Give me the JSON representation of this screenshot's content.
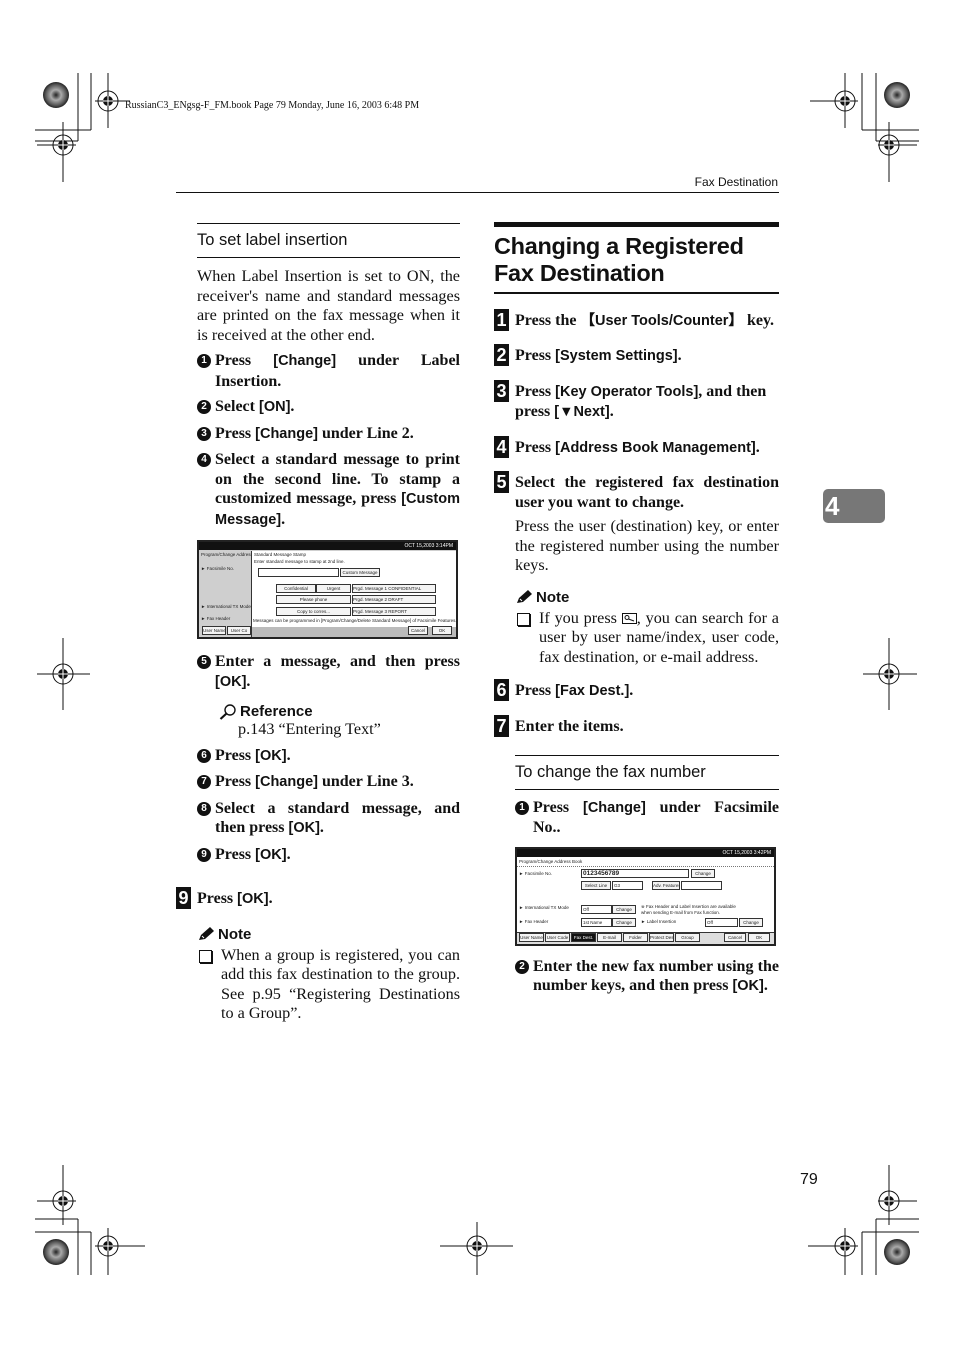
{
  "meta_line": "RussianC3_ENgsg-F_FM.book  Page 79  Monday, June 16, 2003  6:48 PM",
  "running_head": "Fax Destination",
  "chapter_tab": "4",
  "page_number": "79",
  "left": {
    "subhead": "To set label insertion",
    "intro": "When Label Insertion is set to ON, the receiver's name and standard messages are printed on the fax message when it is received at the other end.",
    "steps_a": [
      {
        "num": "1",
        "pre": "Press ",
        "key": "[Change]",
        "post": " under Label Insertion."
      },
      {
        "num": "2",
        "pre": "Select ",
        "key": "[ON]",
        "post": "."
      },
      {
        "num": "3",
        "pre": "Press ",
        "key": "[Change]",
        "post": " under Line 2."
      },
      {
        "num": "4",
        "pre": "Select a standard message to print on the second line. To stamp a customized message, press ",
        "key": "[Custom Message]",
        "post": "."
      }
    ],
    "screen1": {
      "clock": "OCT  15,2003  3:14PM",
      "side_title": "Program/Change Address B",
      "side_items": [
        "► Facsimile No.",
        "► International TX Mode",
        "► Fax Header"
      ],
      "side_tabs": [
        "User Name",
        "User Co"
      ],
      "dialog_title": "Standard Message Stamp",
      "dialog_prompt": "Enter standard message to stamp at 2nd line.",
      "custom_button": "Custom Message",
      "messages": [
        "Confidential",
        "Urgent",
        "Please phone",
        "Copy to corres..."
      ],
      "prgd": [
        {
          "label": "Prgd. Message 1",
          "value": "CONFIDENTIAL"
        },
        {
          "label": "Prgd. Message 2",
          "value": "DRAFT"
        },
        {
          "label": "Prgd. Message 3",
          "value": "REPORT"
        }
      ],
      "footer_note": "Messages can be programmed in [Program/Change/Delete Standard Message] of Facsimile Features.",
      "cancel": "Cancel",
      "ok": "OK"
    },
    "steps_b": [
      {
        "num": "5",
        "pre": "Enter a message, and then press ",
        "key": "[OK]",
        "post": "."
      }
    ],
    "reference_title": "Reference",
    "reference_text": "p.143 “Entering Text”",
    "steps_c": [
      {
        "num": "6",
        "pre": "Press ",
        "key": "[OK]",
        "post": "."
      },
      {
        "num": "7",
        "pre": "Press ",
        "key": "[Change]",
        "post": " under Line 3."
      },
      {
        "num": "8",
        "pre": "Select a standard message, and then press ",
        "key": "[OK]",
        "post": "."
      },
      {
        "num": "9",
        "pre": "Press ",
        "key": "[OK]",
        "post": "."
      }
    ],
    "big_step": {
      "num": "9",
      "pre": "Press ",
      "key": "[OK]",
      "post": "."
    },
    "note_title": "Note",
    "note_text": "When a group is registered, you can add this fax destination to the group. See p.95 “Registering Destinations to a Group”."
  },
  "right": {
    "title": "Changing a Registered Fax Destination",
    "steps": [
      {
        "num": "1",
        "pre": "Press the ",
        "key": "【User Tools/Counter】",
        "post": " key."
      },
      {
        "num": "2",
        "pre": "Press ",
        "key": "[System Settings]",
        "post": "."
      },
      {
        "num": "3",
        "pre": "Press ",
        "key": "[Key Operator Tools]",
        "post": ", and then press ",
        "key2": "[▼Next]",
        "post2": "."
      },
      {
        "num": "4",
        "pre": "Press ",
        "key": "[Address Book Management]",
        "post": "."
      },
      {
        "num": "5",
        "pre": "Select the registered fax destination user you want to change.",
        "key": "",
        "post": ""
      }
    ],
    "step5_body": "Press the user (destination) key, or enter the registered number using the number keys.",
    "note_title": "Note",
    "note_pre": "If you press ",
    "note_post": ", you can search for a user by user name/index, user code, fax destination, or e-mail address.",
    "steps2": [
      {
        "num": "6",
        "pre": "Press ",
        "key": "[Fax Dest.]",
        "post": "."
      },
      {
        "num": "7",
        "pre": "Enter the items.",
        "key": "",
        "post": ""
      }
    ],
    "subhead": "To change the fax number",
    "sub_steps_a": [
      {
        "num": "1",
        "pre": "Press ",
        "key": "[Change]",
        "post": " under Facsimile No.."
      }
    ],
    "screen2": {
      "clock": "OCT  15,2003  3:42PM",
      "title": "Program/Change Address Book",
      "fax_label": "► Facsimile No.",
      "fax_value": "0123456789",
      "change": "Change",
      "select_line": "Select Line",
      "line_value": "G3",
      "adv_features": "Adv. Features",
      "intl_label": "► International TX Mode",
      "intl_value": "Off",
      "header_label": "► Fax Header",
      "header_value": "1st Name",
      "info": "※ Fax Header and Label Insertion are available when sending E-mail from Fax function.",
      "label_ins_label": "► Label Insertion",
      "label_ins_value": "Off",
      "tabs": [
        "User Name",
        "User Code",
        "Fax Dest.",
        "E-mail",
        "Folder",
        "Protect Dest.",
        "Group"
      ],
      "active_tab": "Fax Dest.",
      "cancel": "Cancel",
      "ok": "OK"
    },
    "sub_steps_b": [
      {
        "num": "2",
        "pre": "Enter the new fax number using the number keys, and then press ",
        "key": "[OK]",
        "post": "."
      }
    ]
  }
}
